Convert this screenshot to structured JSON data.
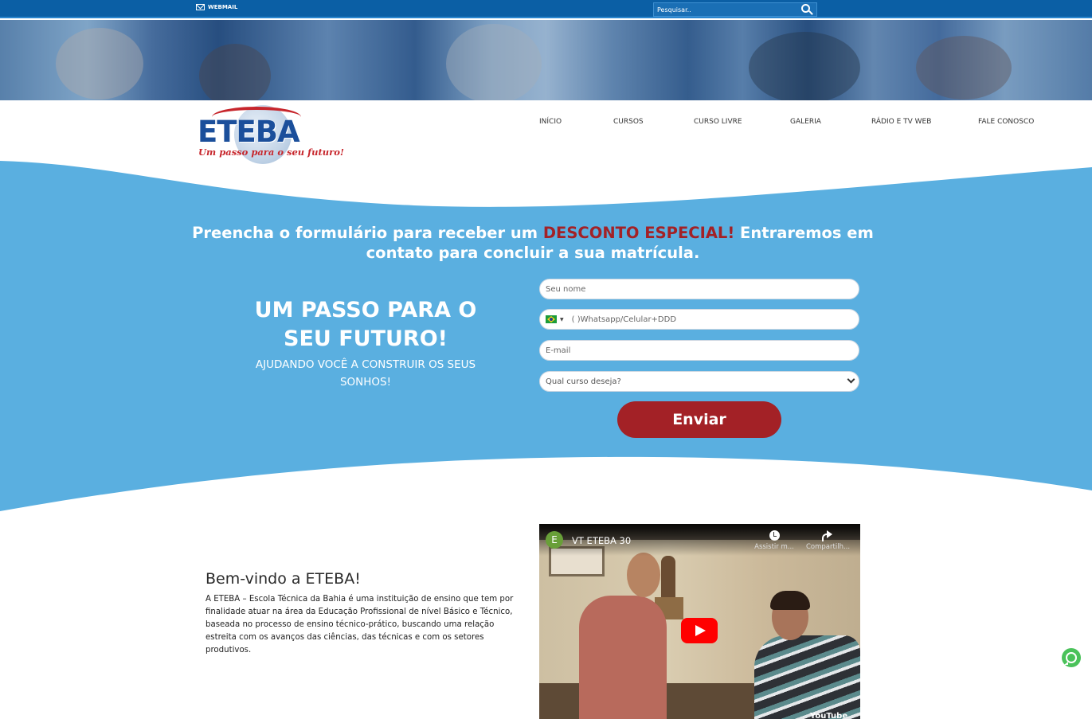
{
  "topbar": {
    "webmail_label": "WEBMAIL",
    "search_placeholder": "Pesquisar.."
  },
  "logo": {
    "name": "ETEBA",
    "tagline": "Um passo para o seu futuro!"
  },
  "nav": {
    "items": [
      {
        "label": "INÍCIO"
      },
      {
        "label": "CURSOS"
      },
      {
        "label": "CURSO LIVRE"
      },
      {
        "label": "GALERIA"
      },
      {
        "label": "RÁDIO E TV WEB"
      },
      {
        "label": "FALE CONOSCO"
      }
    ]
  },
  "hero": {
    "headline_part1": "Preencha o formulário para receber um ",
    "headline_highlight": "DESCONTO ESPECIAL!",
    "headline_part2": " Entraremos em contato para concluir a sua matrícula.",
    "slogan": "UM PASSO PARA O SEU FUTURO!",
    "slogan_sub": "AJUDANDO VOCÊ A CONSTRUIR OS SEUS SONHOS!"
  },
  "form": {
    "name_placeholder": "Seu nome",
    "phone_placeholder": "( )Whatsapp/Celular+DDD",
    "email_placeholder": "E-mail",
    "course_selected": "Qual curso deseja?",
    "submit_label": "Enviar"
  },
  "welcome": {
    "title": "Bem-vindo a ETEBA!",
    "text": "A ETEBA – Escola Técnica da Bahia é uma instituição de ensino que tem por finalidade atuar na área da Educação Profissional de nível Básico e Técnico, baseada no processo de ensino técnico-prático, buscando uma relação estreita com os avanços das ciências, das técnicas e com os setores produtivos."
  },
  "video": {
    "channel_initial": "E",
    "title": "VT ETEBA 30",
    "watch_later_label": "Assistir m...",
    "share_label": "Compartilh...",
    "platform_label": "YouTube"
  },
  "colors": {
    "topbar": "#0b5fa5",
    "wave_blue": "#5aafe0",
    "accent_red": "#a32126",
    "logo_blue": "#1b4f9b"
  }
}
